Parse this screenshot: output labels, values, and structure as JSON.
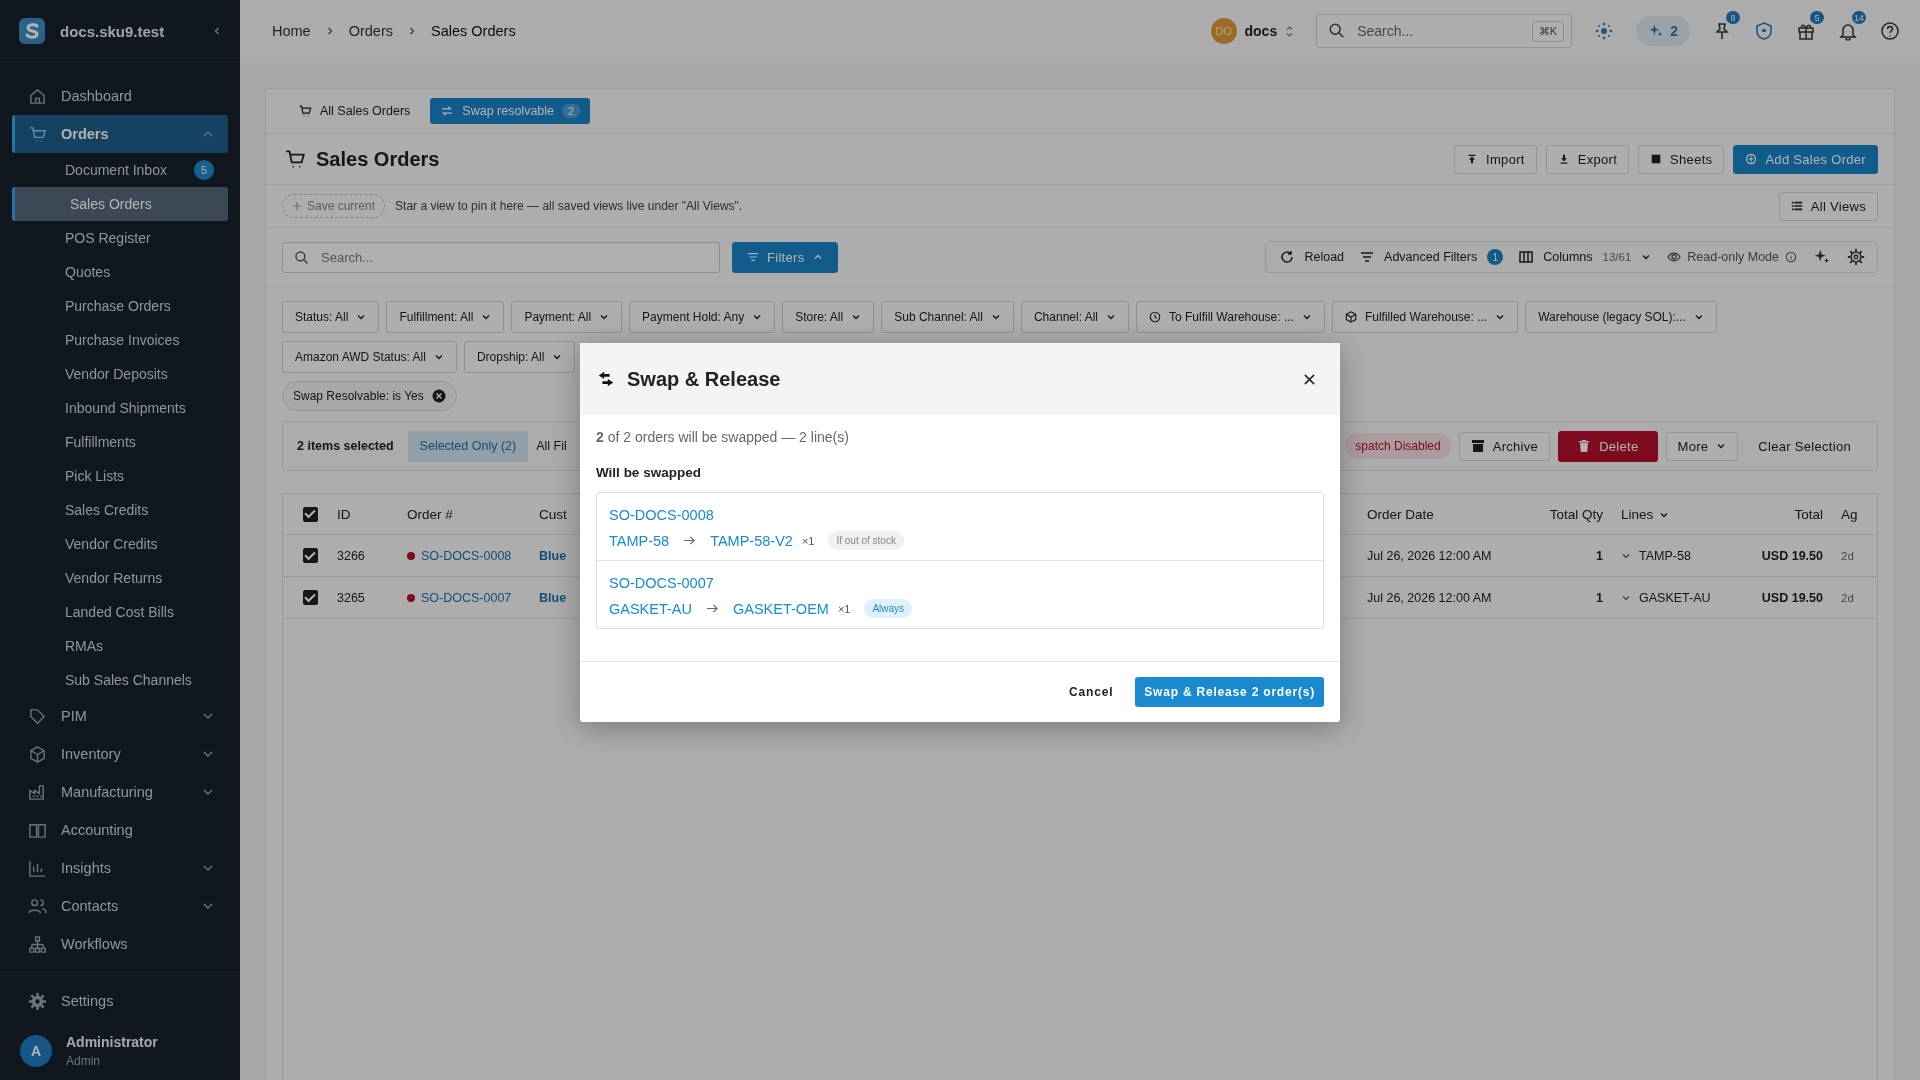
{
  "sidebar": {
    "brand": "docs.sku9.test",
    "items": [
      {
        "label": "Dashboard",
        "kind": "link",
        "selected": false
      },
      {
        "label": "Orders",
        "kind": "group",
        "expanded": true,
        "selected": true,
        "children": [
          {
            "label": "Document Inbox",
            "badge": "5",
            "selected": false
          },
          {
            "label": "Sales Orders",
            "selected": true
          },
          {
            "label": "POS Register",
            "selected": false
          },
          {
            "label": "Quotes",
            "selected": false
          },
          {
            "label": "Purchase Orders",
            "selected": false
          },
          {
            "label": "Purchase Invoices",
            "selected": false
          },
          {
            "label": "Vendor Deposits",
            "selected": false
          },
          {
            "label": "Inbound Shipments",
            "selected": false
          },
          {
            "label": "Fulfillments",
            "selected": false
          },
          {
            "label": "Pick Lists",
            "selected": false
          },
          {
            "label": "Sales Credits",
            "selected": false
          },
          {
            "label": "Vendor Credits",
            "selected": false
          },
          {
            "label": "Vendor Returns",
            "selected": false
          },
          {
            "label": "Landed Cost Bills",
            "selected": false
          },
          {
            "label": "RMAs",
            "selected": false
          },
          {
            "label": "Sub Sales Channels",
            "selected": false
          }
        ]
      },
      {
        "label": "PIM",
        "kind": "group",
        "expanded": false,
        "selected": false
      },
      {
        "label": "Inventory",
        "kind": "group",
        "expanded": false,
        "selected": false
      },
      {
        "label": "Manufacturing",
        "kind": "group",
        "expanded": false,
        "selected": false
      },
      {
        "label": "Accounting",
        "kind": "link",
        "selected": false
      },
      {
        "label": "Insights",
        "kind": "group",
        "expanded": false,
        "selected": false
      },
      {
        "label": "Contacts",
        "kind": "group",
        "expanded": false,
        "selected": false
      },
      {
        "label": "Workflows",
        "kind": "link",
        "selected": false
      }
    ],
    "settings": "Settings",
    "user": {
      "initial": "A",
      "name": "Administrator",
      "role": "Admin"
    }
  },
  "topbar": {
    "breadcrumb": [
      "Home",
      "Orders",
      "Sales Orders"
    ],
    "workspace": {
      "initials": "DO",
      "name": "docs"
    },
    "search": {
      "placeholder": "Search...",
      "shortcut": "⌘K"
    },
    "ai_count": "2",
    "pin_badge": "8",
    "gift_badge": "5",
    "bell_badge": "14"
  },
  "view_tabs": [
    {
      "label": "All Sales Orders",
      "selected": false
    },
    {
      "label": "Swap resolvable",
      "selected": true,
      "count": "2"
    }
  ],
  "page": {
    "title": "Sales Orders",
    "actions": [
      {
        "label": "Import",
        "kind": "import"
      },
      {
        "label": "Export",
        "kind": "export"
      },
      {
        "label": "Sheets",
        "kind": "sheets"
      },
      {
        "label": "Add Sales Order",
        "kind": "primary"
      }
    ]
  },
  "saved_views": {
    "save_label": "Save current",
    "hint": "Star a view to pin it here — all saved views live under \"All Views\".",
    "all_views": "All Views"
  },
  "toolbar": {
    "search_placeholder": "Search...",
    "filters_label": "Filters",
    "reload": "Reload",
    "advanced_filters": "Advanced Filters",
    "advanced_count": "1",
    "columns": "Columns",
    "columns_count": "13/61",
    "read_only": "Read-only Mode"
  },
  "filter_dropdowns": [
    {
      "label": "Status: All",
      "kind": "plain"
    },
    {
      "label": "Fulfillment: All",
      "kind": "plain"
    },
    {
      "label": "Payment: All",
      "kind": "plain"
    },
    {
      "label": "Payment Hold: Any",
      "kind": "plain"
    },
    {
      "label": "Store: All",
      "kind": "plain"
    },
    {
      "label": "Sub Channel: All",
      "kind": "plain"
    },
    {
      "label": "Channel: All",
      "kind": "plain"
    },
    {
      "label": "To Fulfill Warehouse: ...",
      "kind": "time"
    },
    {
      "label": "Fulfilled Warehouse: ...",
      "kind": "package"
    },
    {
      "label": "Warehouse (legacy SOL):...",
      "kind": "plain"
    },
    {
      "label": "Amazon AWD Status: All",
      "kind": "plain"
    },
    {
      "label": "Dropship: All",
      "kind": "plain"
    }
  ],
  "active_filters": [
    {
      "label": "Swap Resolvable: is Yes"
    }
  ],
  "bulk_bar": {
    "selected_text": "2 items selected",
    "segments": [
      {
        "label": "Selected Only (2)",
        "selected": true
      },
      {
        "label": "All Fil",
        "selected": false
      }
    ],
    "actions": [
      {
        "label": "spatch Disabled",
        "kind": "danger_pill"
      },
      {
        "label": "Archive",
        "kind": "archive"
      },
      {
        "label": "Delete",
        "kind": "danger"
      },
      {
        "label": "More",
        "kind": "menu"
      },
      {
        "label": "Clear Selection",
        "kind": "text"
      }
    ]
  },
  "table": {
    "all_checked": true,
    "columns_left": [
      "ID",
      "Order #",
      "Cust"
    ],
    "columns_right": [
      "Order Date",
      "Total Qty",
      "Lines",
      "Total",
      "Ag"
    ],
    "rows": [
      {
        "checked": true,
        "id": "3266",
        "order": "SO-DOCS-0008",
        "customer": "Blue",
        "order_date": "Jul 26, 2026 12:00 AM",
        "total_qty": "1",
        "lines": "TAMP-58",
        "total": "USD 19.50",
        "age": "2d"
      },
      {
        "checked": true,
        "id": "3265",
        "order": "SO-DOCS-0007",
        "customer": "Blue",
        "order_date": "Jul 26, 2026 12:00 AM",
        "total_qty": "1",
        "lines": "GASKET-AU",
        "total": "USD 19.50",
        "age": "2d"
      }
    ]
  },
  "dialog": {
    "title": "Swap & Release",
    "summary": "**2** of 2 orders will be swapped — 2 line(s)",
    "section_title": "Will be swapped",
    "orders": [
      {
        "order": "SO-DOCS-0008",
        "from": "TAMP-58",
        "to": "TAMP-58-V2",
        "qty": "×1",
        "policy": {
          "label": "If out of stock",
          "kind": "conditional"
        }
      },
      {
        "order": "SO-DOCS-0007",
        "from": "GASKET-AU",
        "to": "GASKET-OEM",
        "qty": "×1",
        "policy": {
          "label": "Always",
          "kind": "always"
        }
      }
    ],
    "cancel": "Cancel",
    "confirm": "Swap & Release 2 order(s)"
  }
}
